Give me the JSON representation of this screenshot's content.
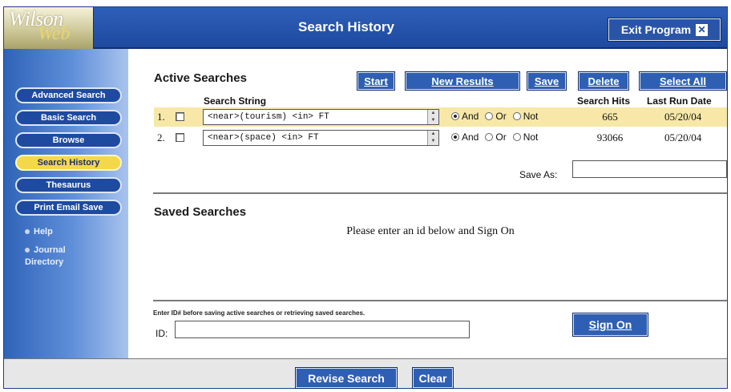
{
  "header": {
    "logo_top": "Wilson",
    "logo_bottom": "Web",
    "title": "Search History",
    "exit_label": "Exit Program",
    "exit_icon": "close-box-icon"
  },
  "sidebar": {
    "items": [
      {
        "label": "Advanced Search"
      },
      {
        "label": "Basic Search"
      },
      {
        "label": "Browse"
      },
      {
        "label": "Search History",
        "active": true
      },
      {
        "label": "Thesaurus"
      },
      {
        "label": "Print Email Save"
      }
    ],
    "links": [
      {
        "label": "Help"
      },
      {
        "label": "Journal Directory"
      }
    ]
  },
  "active": {
    "title": "Active Searches",
    "buttons": {
      "start": "Start",
      "new_results": "New Results",
      "save": "Save",
      "delete": "Delete",
      "select_all": "Select All"
    },
    "columns": {
      "search_string": "Search String",
      "hits": "Search Hits",
      "date": "Last Run Date"
    },
    "radio_labels": {
      "and": "And",
      "or": "Or",
      "not": "Not"
    },
    "rows": [
      {
        "num": "1.",
        "query": "<near>(tourism) <in> FT",
        "bool": "And",
        "hits": "665",
        "date": "05/20/04",
        "highlighted": true
      },
      {
        "num": "2.",
        "query": "<near>(space) <in> FT",
        "bool": "And",
        "hits": "93066",
        "date": "05/20/04",
        "highlighted": false
      }
    ],
    "save_as_label": "Save As:",
    "save_as_value": ""
  },
  "saved": {
    "title": "Saved Searches",
    "message": "Please enter an id below and Sign On"
  },
  "signon": {
    "hint": "Enter ID# before saving active searches or retrieving saved searches.",
    "id_label": "ID:",
    "id_value": "",
    "button": "Sign On"
  },
  "footer": {
    "revise": "Revise Search",
    "clear": "Clear"
  },
  "colors": {
    "brand_blue": "#2f5fb2",
    "highlight_row": "#f7e8a8",
    "active_nav": "#f3d84a"
  }
}
